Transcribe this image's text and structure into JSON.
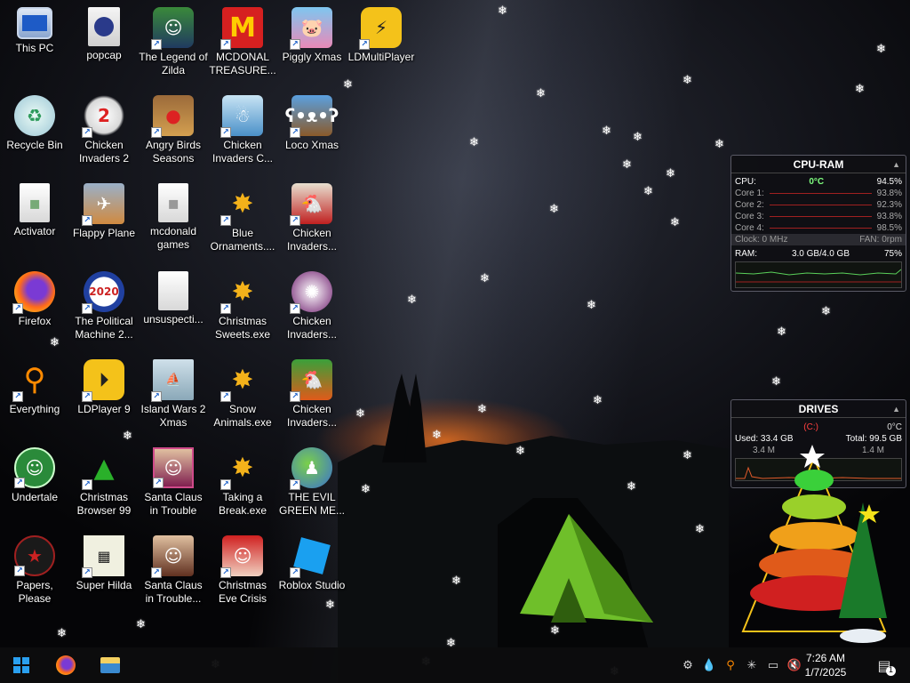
{
  "desktop": {
    "icons": [
      {
        "label": "This PC",
        "icon": "computer-icon"
      },
      {
        "label": "popcap",
        "icon": "folder-icon"
      },
      {
        "label": "The Legend of Zilda",
        "icon": "game-icon"
      },
      {
        "label": "MCDONAL TREASURE...",
        "icon": "mcdonalds-icon"
      },
      {
        "label": "Piggly Xmas",
        "icon": "pig-icon"
      },
      {
        "label": "LDMultiPlayer",
        "icon": "ldmultiplayer-icon"
      },
      {
        "label": "Recycle Bin",
        "icon": "recycle-bin-icon"
      },
      {
        "label": "Chicken Invaders 2",
        "icon": "chicken-icon"
      },
      {
        "label": "Angry Birds Seasons",
        "icon": "angry-birds-icon"
      },
      {
        "label": "Chicken Invaders C...",
        "icon": "chicken-icon"
      },
      {
        "label": "Loco Xmas",
        "icon": "bear-icon"
      },
      {
        "label": "Activator",
        "icon": "file-icon"
      },
      {
        "label": "Flappy Plane",
        "icon": "plane-icon"
      },
      {
        "label": "mcdonald games",
        "icon": "file-icon"
      },
      {
        "label": "Blue Ornaments....",
        "icon": "ornament-icon"
      },
      {
        "label": "Chicken Invaders...",
        "icon": "chicken-icon"
      },
      {
        "label": "Firefox",
        "icon": "firefox-icon"
      },
      {
        "label": "The Political Machine 2...",
        "icon": "political-icon"
      },
      {
        "label": "unsuspecti...",
        "icon": "file-icon"
      },
      {
        "label": "Christmas Sweets.exe",
        "icon": "ornament-icon"
      },
      {
        "label": "Chicken Invaders...",
        "icon": "chicken-icon"
      },
      {
        "label": "Everything",
        "icon": "search-icon"
      },
      {
        "label": "LDPlayer 9",
        "icon": "ldplayer-icon"
      },
      {
        "label": "Island Wars 2 Xmas",
        "icon": "island-icon"
      },
      {
        "label": "Snow Animals.exe",
        "icon": "ornament-icon"
      },
      {
        "label": "Chicken Invaders...",
        "icon": "chicken-icon"
      },
      {
        "label": "Undertale",
        "icon": "undertale-icon"
      },
      {
        "label": "Christmas Browser 99",
        "icon": "tree-icon"
      },
      {
        "label": "Santa Claus in Trouble",
        "icon": "santa-icon"
      },
      {
        "label": "Taking a Break.exe",
        "icon": "ornament-icon"
      },
      {
        "label": "THE EVIL GREEN ME...",
        "icon": "messenger-icon"
      },
      {
        "label": "Papers, Please",
        "icon": "papers-please-icon"
      },
      {
        "label": "Super Hilda",
        "icon": "pixel-icon"
      },
      {
        "label": "Santa Claus in Trouble... A...",
        "icon": "santa-icon"
      },
      {
        "label": "Christmas Eve Crisis",
        "icon": "santa-icon"
      },
      {
        "label": "Roblox Studio",
        "icon": "roblox-icon"
      }
    ]
  },
  "cpu_ram": {
    "title": "CPU-RAM",
    "cpu_label": "CPU:",
    "cpu_temp": "0°C",
    "cpu_percent": "94.5%",
    "cores": [
      {
        "label": "Core 1:",
        "value": "93.8%"
      },
      {
        "label": "Core 2:",
        "value": "92.3%"
      },
      {
        "label": "Core 3:",
        "value": "93.8%"
      },
      {
        "label": "Core 4:",
        "value": "98.5%"
      }
    ],
    "clock": "Clock: 0 MHz",
    "fan": "FAN: 0rpm",
    "ram_label": "RAM:",
    "ram_usage": "3.0 GB/4.0 GB",
    "ram_percent": "75%"
  },
  "drives": {
    "title": "DRIVES",
    "drive": "(C:)",
    "temp": "0°C",
    "used": "Used: 33.4 GB",
    "total": "Total: 99.5 GB",
    "read": "3.4 M",
    "write": "1.4 M"
  },
  "taskbar": {
    "start_icon": "windows-icon",
    "pinned": [
      "firefox-icon",
      "file-explorer-icon"
    ],
    "time": "7:26 AM",
    "date": "1/7/2025",
    "notification_count": "1"
  },
  "colors": {
    "gadget_accent": "#ff4040",
    "cpu_temp_color": "#7fff7f"
  }
}
